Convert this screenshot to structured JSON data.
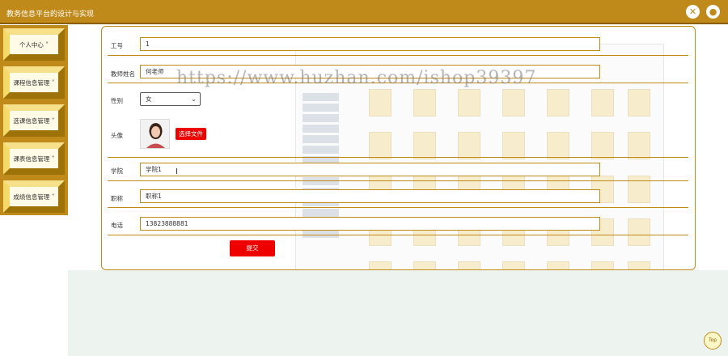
{
  "header": {
    "title": "教务信息平台的设计与实现"
  },
  "sidebar": {
    "items": [
      {
        "label": "个人中心"
      },
      {
        "label": "课程信息管理"
      },
      {
        "label": "选课信息管理"
      },
      {
        "label": "课表信息管理"
      },
      {
        "label": "成绩信息管理"
      }
    ]
  },
  "form": {
    "fields": [
      {
        "label": "工号",
        "value": "1"
      },
      {
        "label": "教师姓名",
        "value": "何老师"
      },
      {
        "label": "性别",
        "value": "女"
      },
      {
        "label": "头像",
        "button": "选择文件"
      },
      {
        "label": "学院",
        "value": "学院1"
      },
      {
        "label": "职称",
        "value": "职称1"
      },
      {
        "label": "电话",
        "value": "13823888881"
      }
    ],
    "submit": "提交"
  },
  "watermark": "https://www.huzhan.com/ishop39397",
  "top_button": "Top",
  "colors": {
    "brand": "#c08a1a",
    "button": "#ef0000",
    "sidebar_tile": "#e2b520"
  }
}
